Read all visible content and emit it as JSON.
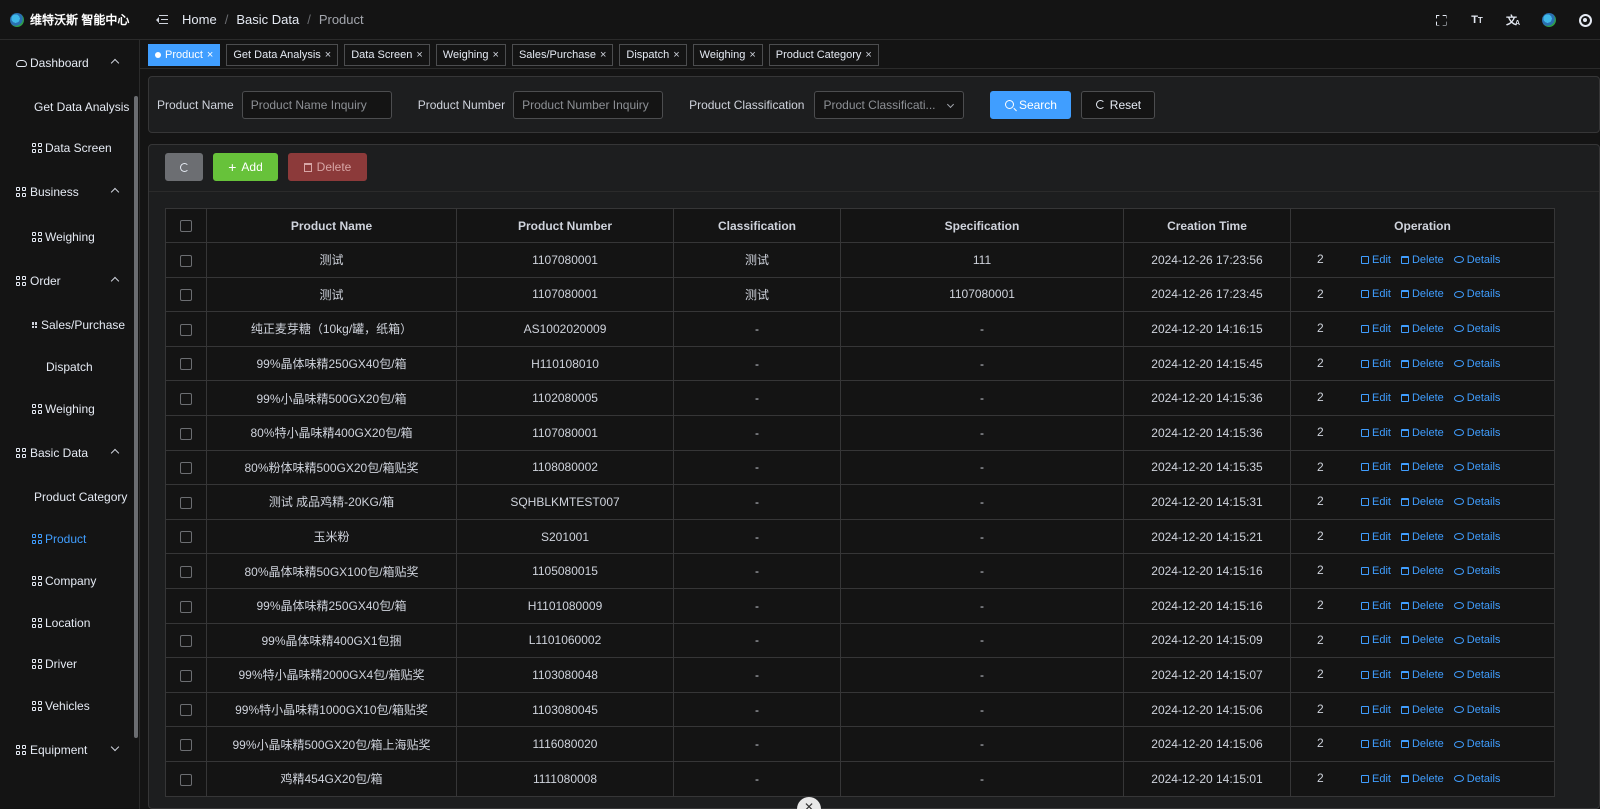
{
  "app": {
    "title": "维特沃斯 智能中心"
  },
  "breadcrumb": [
    "Home",
    "Basic Data",
    "Product"
  ],
  "header_tools": [
    "fullscreen-icon",
    "font-size-icon",
    "translate-icon",
    "avatar",
    "gear-icon"
  ],
  "sidebar": {
    "groups": [
      {
        "label": "Dashboard",
        "icon": "cloud-icon",
        "expanded": true,
        "items": [
          {
            "label": "Get Data Analysis",
            "icon": "none"
          },
          {
            "label": "Data Screen",
            "icon": "grid-icon"
          }
        ]
      },
      {
        "label": "Business",
        "icon": "grid-icon",
        "expanded": true,
        "items": [
          {
            "label": "Weighing",
            "icon": "grid-icon"
          }
        ]
      },
      {
        "label": "Order",
        "icon": "grid-icon",
        "expanded": true,
        "items": [
          {
            "label": "Sales/Purchase",
            "icon": "mini-grid-icon"
          },
          {
            "label": "Dispatch",
            "icon": "none"
          },
          {
            "label": "Weighing",
            "icon": "grid-icon"
          }
        ]
      },
      {
        "label": "Basic Data",
        "icon": "grid-icon",
        "expanded": true,
        "items": [
          {
            "label": "Product Category",
            "icon": "none"
          },
          {
            "label": "Product",
            "icon": "grid-icon",
            "active": true
          },
          {
            "label": "Company",
            "icon": "grid-icon"
          },
          {
            "label": "Location",
            "icon": "grid-icon"
          },
          {
            "label": "Driver",
            "icon": "grid-icon"
          },
          {
            "label": "Vehicles",
            "icon": "grid-icon"
          }
        ]
      },
      {
        "label": "Equipment",
        "icon": "grid-icon",
        "expanded": false,
        "items": []
      }
    ]
  },
  "tabs": [
    {
      "label": "Product",
      "active": true
    },
    {
      "label": "Get Data Analysis"
    },
    {
      "label": "Data Screen"
    },
    {
      "label": "Weighing"
    },
    {
      "label": "Sales/Purchase"
    },
    {
      "label": "Dispatch"
    },
    {
      "label": "Weighing"
    },
    {
      "label": "Product Category"
    }
  ],
  "search": {
    "product_name_label": "Product Name",
    "product_name_placeholder": "Product Name Inquiry",
    "product_number_label": "Product Number",
    "product_number_placeholder": "Product Number Inquiry",
    "classification_label": "Product Classification",
    "classification_placeholder": "Product Classificati...",
    "search_label": "Search",
    "reset_label": "Reset"
  },
  "toolbar": {
    "add_label": "Add",
    "delete_label": "Delete"
  },
  "table": {
    "headers": [
      "Product Name",
      "Product Number",
      "Classification",
      "Specification",
      "Creation Time",
      "Operation"
    ],
    "op_labels": {
      "edit": "Edit",
      "delete": "Delete",
      "details": "Details"
    },
    "op_cut_text": "2",
    "rows": [
      [
        "测试",
        "1107080001",
        "测试",
        "111",
        "2024-12-26 17:23:56"
      ],
      [
        "测试",
        "1107080001",
        "测试",
        "1107080001",
        "2024-12-26 17:23:45"
      ],
      [
        "纯正麦芽糖（10kg/罐，纸箱）",
        "AS1002020009",
        "-",
        "-",
        "2024-12-20 14:16:15"
      ],
      [
        "99%晶体味精250GX40包/箱",
        "H110108010",
        "-",
        "-",
        "2024-12-20 14:15:45"
      ],
      [
        "99%小晶味精500GX20包/箱",
        "1102080005",
        "-",
        "-",
        "2024-12-20 14:15:36"
      ],
      [
        "80%特小晶味精400GX20包/箱",
        "1107080001",
        "-",
        "-",
        "2024-12-20 14:15:36"
      ],
      [
        "80%粉体味精500GX20包/箱贴奖",
        "1108080002",
        "-",
        "-",
        "2024-12-20 14:15:35"
      ],
      [
        "测试 成品鸡精-20KG/箱",
        "SQHBLKMTEST007",
        "-",
        "-",
        "2024-12-20 14:15:31"
      ],
      [
        "玉米粉",
        "S201001",
        "-",
        "-",
        "2024-12-20 14:15:21"
      ],
      [
        "80%晶体味精50GX100包/箱贴奖",
        "1105080015",
        "-",
        "-",
        "2024-12-20 14:15:16"
      ],
      [
        "99%晶体味精250GX40包/箱",
        "H1101080009",
        "-",
        "-",
        "2024-12-20 14:15:16"
      ],
      [
        "99%晶体味精400GX1包捆",
        "L1101060002",
        "-",
        "-",
        "2024-12-20 14:15:09"
      ],
      [
        "99%特小晶味精2000GX4包/箱贴奖",
        "1103080048",
        "-",
        "-",
        "2024-12-20 14:15:07"
      ],
      [
        "99%特小晶味精1000GX10包/箱贴奖",
        "1103080045",
        "-",
        "-",
        "2024-12-20 14:15:06"
      ],
      [
        "99%小晶味精500GX20包/箱上海贴奖",
        "1116080020",
        "-",
        "-",
        "2024-12-20 14:15:06"
      ],
      [
        "鸡精454GX20包/箱",
        "1111080008",
        "-",
        "-",
        "2024-12-20 14:15:01"
      ]
    ]
  },
  "colors": {
    "primary": "#409eff",
    "success": "#67c23a",
    "danger_dim": "#8c3a3a",
    "bg": "#141414",
    "panel": "#1d1e1f"
  }
}
